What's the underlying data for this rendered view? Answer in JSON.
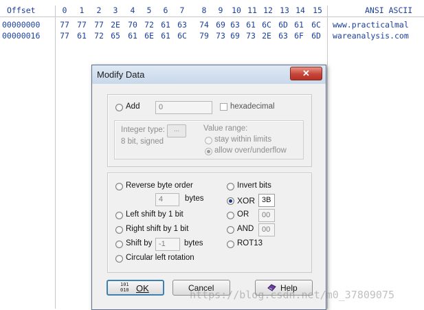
{
  "hex_editor": {
    "offset_header": "Offset",
    "columns": [
      "0",
      "1",
      "2",
      "3",
      "4",
      "5",
      "6",
      "7",
      "8",
      "9",
      "10",
      "11",
      "12",
      "13",
      "14",
      "15"
    ],
    "ascii_header": "ANSI ASCII",
    "rows": [
      {
        "offset": "00000000",
        "bytes": [
          "77",
          "77",
          "77",
          "2E",
          "70",
          "72",
          "61",
          "63",
          "74",
          "69",
          "63",
          "61",
          "6C",
          "6D",
          "61",
          "6C"
        ],
        "ascii": "www.practicalmal"
      },
      {
        "offset": "00000016",
        "bytes": [
          "77",
          "61",
          "72",
          "65",
          "61",
          "6E",
          "61",
          "6C",
          "79",
          "73",
          "69",
          "73",
          "2E",
          "63",
          "6F",
          "6D"
        ],
        "ascii": "wareanalysis.com"
      }
    ]
  },
  "dialog": {
    "title": "Modify Data",
    "close_glyph": "✕",
    "add": {
      "label": "Add",
      "value": "0",
      "hex_label": "hexadecimal"
    },
    "integer_type": {
      "label": "Integer type:",
      "button": "...",
      "value": "8 bit, signed"
    },
    "value_range": {
      "label": "Value range:",
      "option1": "stay within limits",
      "option2": "allow over/underflow"
    },
    "ops": {
      "reverse": "Reverse byte order",
      "bytes_value": "4",
      "bytes_label": "bytes",
      "lshift": "Left shift by 1 bit",
      "rshift": "Right shift by 1 bit",
      "shift_by": "Shift by",
      "shift_value": "-1",
      "shift_bytes": "bytes",
      "circular": "Circular left rotation",
      "invert": "Invert bits",
      "xor": "XOR",
      "xor_value": "3B",
      "or": "OR",
      "or_value": "00",
      "and": "AND",
      "and_value": "00",
      "rot13": "ROT13"
    },
    "buttons": {
      "ok": "OK",
      "ok_icon": "101\n010",
      "cancel": "Cancel",
      "help": "Help"
    }
  },
  "watermark": "https://blog.csdn.net/m0_37809075",
  "colors": {
    "hex_text": "#1a3f9c",
    "accent": "#3c7fb1",
    "close": "#c5453a"
  }
}
